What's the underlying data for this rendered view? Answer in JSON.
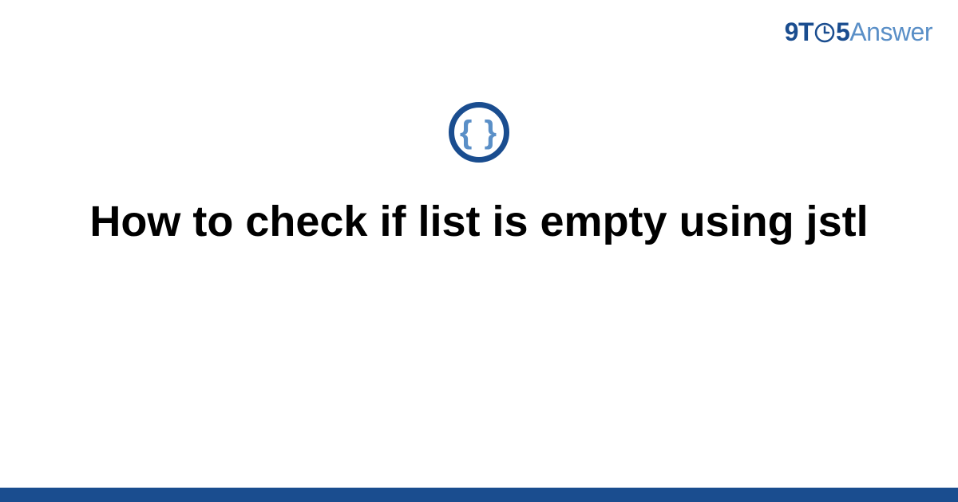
{
  "logo": {
    "part1": "9T",
    "part2": "5",
    "part3": "Answer"
  },
  "icon": {
    "name": "code-braces-icon",
    "glyph": "{ }"
  },
  "title": "How to check if list is empty using jstl",
  "colors": {
    "brand_dark": "#1a4d8f",
    "brand_light": "#5a8fc7"
  }
}
